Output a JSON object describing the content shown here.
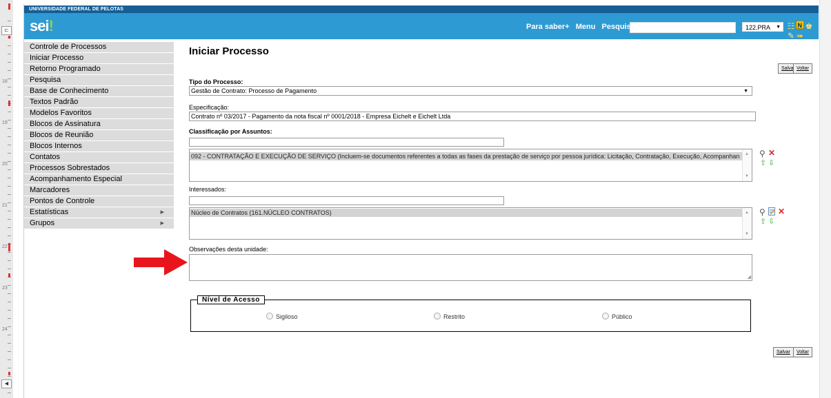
{
  "university": "UNIVERSIDADE FEDERAL DE PELOTAS",
  "logo": {
    "main": "sei",
    "dot": "!"
  },
  "header_links": [
    "Para saber+",
    "Menu",
    "Pesquisa"
  ],
  "search_value": "",
  "unit_select": "122.PRA",
  "menu": [
    {
      "label": "Controle de Processos",
      "arrow": false
    },
    {
      "label": "Iniciar Processo",
      "arrow": false
    },
    {
      "label": "Retorno Programado",
      "arrow": false
    },
    {
      "label": "Pesquisa",
      "arrow": false
    },
    {
      "label": "Base de Conhecimento",
      "arrow": false
    },
    {
      "label": "Textos Padrão",
      "arrow": false
    },
    {
      "label": "Modelos Favoritos",
      "arrow": false
    },
    {
      "label": "Blocos de Assinatura",
      "arrow": false
    },
    {
      "label": "Blocos de Reunião",
      "arrow": false
    },
    {
      "label": "Blocos Internos",
      "arrow": false
    },
    {
      "label": "Contatos",
      "arrow": false
    },
    {
      "label": "Processos Sobrestados",
      "arrow": false
    },
    {
      "label": "Acompanhamento Especial",
      "arrow": false
    },
    {
      "label": "Marcadores",
      "arrow": false
    },
    {
      "label": "Pontos de Controle",
      "arrow": false
    },
    {
      "label": "Estatísticas",
      "arrow": true
    },
    {
      "label": "Grupos",
      "arrow": true
    }
  ],
  "page_title": "Iniciar Processo",
  "buttons": {
    "save": "Salvar",
    "back": "Voltar"
  },
  "form": {
    "tipo_label": "Tipo do Processo:",
    "tipo_value": "Gestão de Contrato: Processo de Pagamento",
    "especificacao_label": "Especificação:",
    "especificacao_value": "Contrato nº 03/2017 - Pagamento da nota fiscal nº 0001/2018 - Empresa Eichelt e Eichelt Ltda",
    "classificacao_label": "Classificação por Assuntos:",
    "classificacao_item": "092 - CONTRATAÇÃO E EXECUÇÃO DE SERVIÇO (Incluem-se documentos referentes a todas as fases da prestação de serviço por pessoa jurídica: Licitação, Contratação, Execução, Acompanhan",
    "interessados_label": "Interessados:",
    "interessados_item": "Núcleo de Contratos (161.NÚCLEO CONTRATOS)",
    "observacoes_label": "Observações desta unidade:",
    "observacoes_value": "",
    "nivel_legend": "Nível de Acesso",
    "radios": [
      "Sigiloso",
      "Restrito",
      "Público"
    ]
  },
  "ruler_numbers": [
    "18",
    "19",
    "20",
    "21",
    "22",
    "23",
    "24"
  ],
  "colors": {
    "header": "#2e9ad3",
    "uni_bar": "#155f96",
    "menu_bg": "#dcdcdc",
    "arrow": "#e8151d"
  }
}
